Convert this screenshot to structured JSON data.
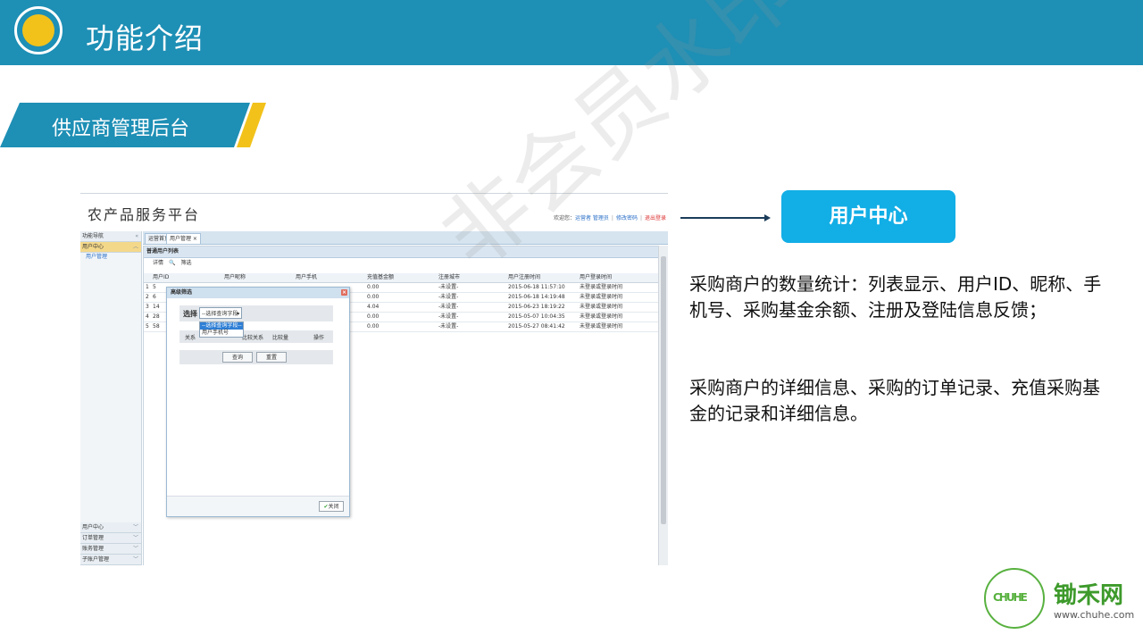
{
  "header": {
    "title": "功能介绍",
    "color": "#1e8fb5",
    "accent": "#f2c21b"
  },
  "section": {
    "label": "供应商管理后台"
  },
  "screenshot": {
    "title": "农产品服务平台",
    "toplinks": {
      "welcome": "欢迎您：",
      "user": "运营者 管理员",
      "change_pwd": "修改密码",
      "logout": "退出登录"
    },
    "sidebar": {
      "header": "功能导航",
      "active_group": "用户中心",
      "active_item": "用户管理",
      "bottom_groups": [
        "用户中心",
        "订单管理",
        "账务管理",
        "子账户管理"
      ]
    },
    "tabs": [
      "运营首页",
      "用户管理 ×"
    ],
    "panel_title": "普通用户列表",
    "toolbar": [
      "详情",
      "筛选"
    ],
    "columns": [
      "用户ID",
      "用户昵称",
      "用户手机",
      "充值基金额",
      "注册城市",
      "用户注册时间",
      "用户登录时间"
    ],
    "rows": [
      [
        "1",
        "5",
        "",
        "",
        "0.00",
        "-未设置-",
        "2015-06-18 11:57:10",
        "未登录或登录时间"
      ],
      [
        "2",
        "6",
        "",
        "",
        "0.00",
        "-未设置-",
        "2015-06-18 14:19:48",
        "未登录或登录时间"
      ],
      [
        "3",
        "14",
        "",
        "",
        "4.04",
        "-未设置-",
        "2015-06-23 18:19:22",
        "未登录或登录时间"
      ],
      [
        "4",
        "28",
        "",
        "",
        "0.00",
        "-未设置-",
        "2015-05-07 10:04:35",
        "未登录或登录时间"
      ],
      [
        "5",
        "58",
        "",
        "",
        "0.00",
        "-未设置-",
        "2015-05-27 08:41:42",
        "未登录或登录时间"
      ]
    ],
    "dialog": {
      "title": "高级筛选",
      "select_label": "选择",
      "select_value": "--选择查询字段--",
      "options": [
        "--选择查询字段--",
        "用户手机号"
      ],
      "filter_headers": [
        "关系",
        "比较关系",
        "比较量",
        "操作"
      ],
      "buttons": [
        "查询",
        "重置"
      ],
      "close_label": "关闭"
    }
  },
  "watermark": "非会员水印",
  "callout": {
    "title": "用户中心",
    "color": "#12aee6",
    "paragraph1": "采购商户的数量统计：列表显示、用户ID、昵称、手机号、采购基金余额、注册及登陆信息反馈；",
    "paragraph2": "采购商户的详细信息、采购的订单记录、充值采购基金的记录和详细信息。"
  },
  "brand": {
    "logo_text": "CHUHE",
    "name": "锄禾网",
    "url": "www.chuhe.com",
    "color": "#58b13f"
  }
}
